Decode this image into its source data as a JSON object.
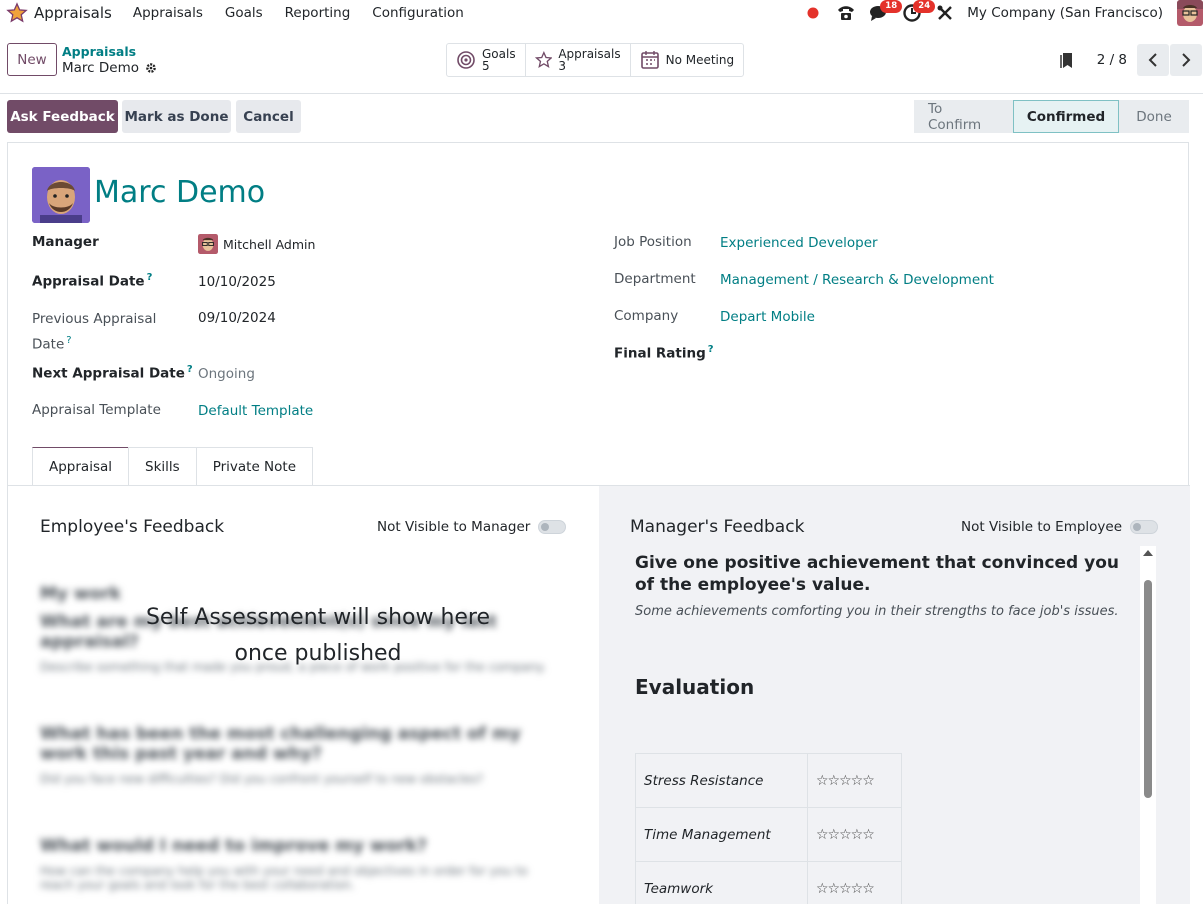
{
  "navbar": {
    "app_name": "Appraisals",
    "menus": [
      "Appraisals",
      "Goals",
      "Reporting",
      "Configuration"
    ],
    "messages_badge": "18",
    "activities_badge": "24",
    "company": "My Company (San Francisco)"
  },
  "control_panel": {
    "new_label": "New",
    "breadcrumb_parent": "Appraisals",
    "breadcrumb_current": "Marc Demo",
    "smart_buttons": {
      "goals_label": "Goals",
      "goals_count": "5",
      "appraisals_label": "Appraisals",
      "appraisals_count": "3",
      "meeting_label": "No Meeting"
    },
    "pager": "2 / 8"
  },
  "actions": {
    "ask_feedback": "Ask Feedback",
    "mark_done": "Mark as Done",
    "cancel": "Cancel"
  },
  "statusbar": {
    "to_confirm": "To Confirm",
    "confirmed": "Confirmed",
    "done": "Done"
  },
  "employee": {
    "name": "Marc Demo"
  },
  "fields_left": {
    "manager_label": "Manager",
    "manager_value": "Mitchell Admin",
    "appraisal_date_label": "Appraisal Date",
    "appraisal_date_value": "10/10/2025",
    "prev_date_label_1": "Previous Appraisal",
    "prev_date_label_2": "Date",
    "prev_date_value": "09/10/2024",
    "next_date_label": "Next Appraisal Date",
    "next_date_value": "Ongoing",
    "template_label": "Appraisal Template",
    "template_value": "Default Template",
    "help_mark": "?"
  },
  "fields_right": {
    "job_label": "Job Position",
    "job_value": "Experienced Developer",
    "dept_label": "Department",
    "dept_value": "Management / Research & Development",
    "company_label": "Company",
    "company_value": "Depart Mobile",
    "rating_label": "Final Rating"
  },
  "tabs": [
    "Appraisal",
    "Skills",
    "Private Note"
  ],
  "employee_feedback": {
    "title": "Employee's Feedback",
    "visibility": "Not Visible to Manager",
    "visibility_on": false,
    "overlay_line1": "Self Assessment will show here",
    "overlay_line2": "once published",
    "blurred": {
      "heading": "My work",
      "q1": "What are my best achievement(s) since my last appraisal?",
      "h1": "Describe something that made you proud, a piece of work positive for the company.",
      "q2": "What has been the most challenging aspect of my work this past year and why?",
      "h2": "Did you face new difficulties? Did you confront yourself to new obstacles?",
      "q3": "What would I need to improve my work?",
      "h3": "How can the company help you with your need and objectives in order for you to reach your goals and look for the best collaboration."
    }
  },
  "manager_feedback": {
    "title": "Manager's Feedback",
    "visibility": "Not Visible to Employee",
    "visibility_on": false,
    "question": "Give one positive achievement that convinced you of the employee's value.",
    "hint": "Some achievements comforting you in their strengths to face job's issues.",
    "evaluation_title": "Evaluation",
    "evaluation_rows": [
      {
        "criterion": "Stress Resistance",
        "stars": "☆☆☆☆☆"
      },
      {
        "criterion": "Time Management",
        "stars": "☆☆☆☆☆"
      },
      {
        "criterion": "Teamwork",
        "stars": "☆☆☆☆☆"
      }
    ]
  },
  "colors": {
    "brand": "#714b67",
    "link": "#017e84",
    "badge": "#e4322b"
  }
}
